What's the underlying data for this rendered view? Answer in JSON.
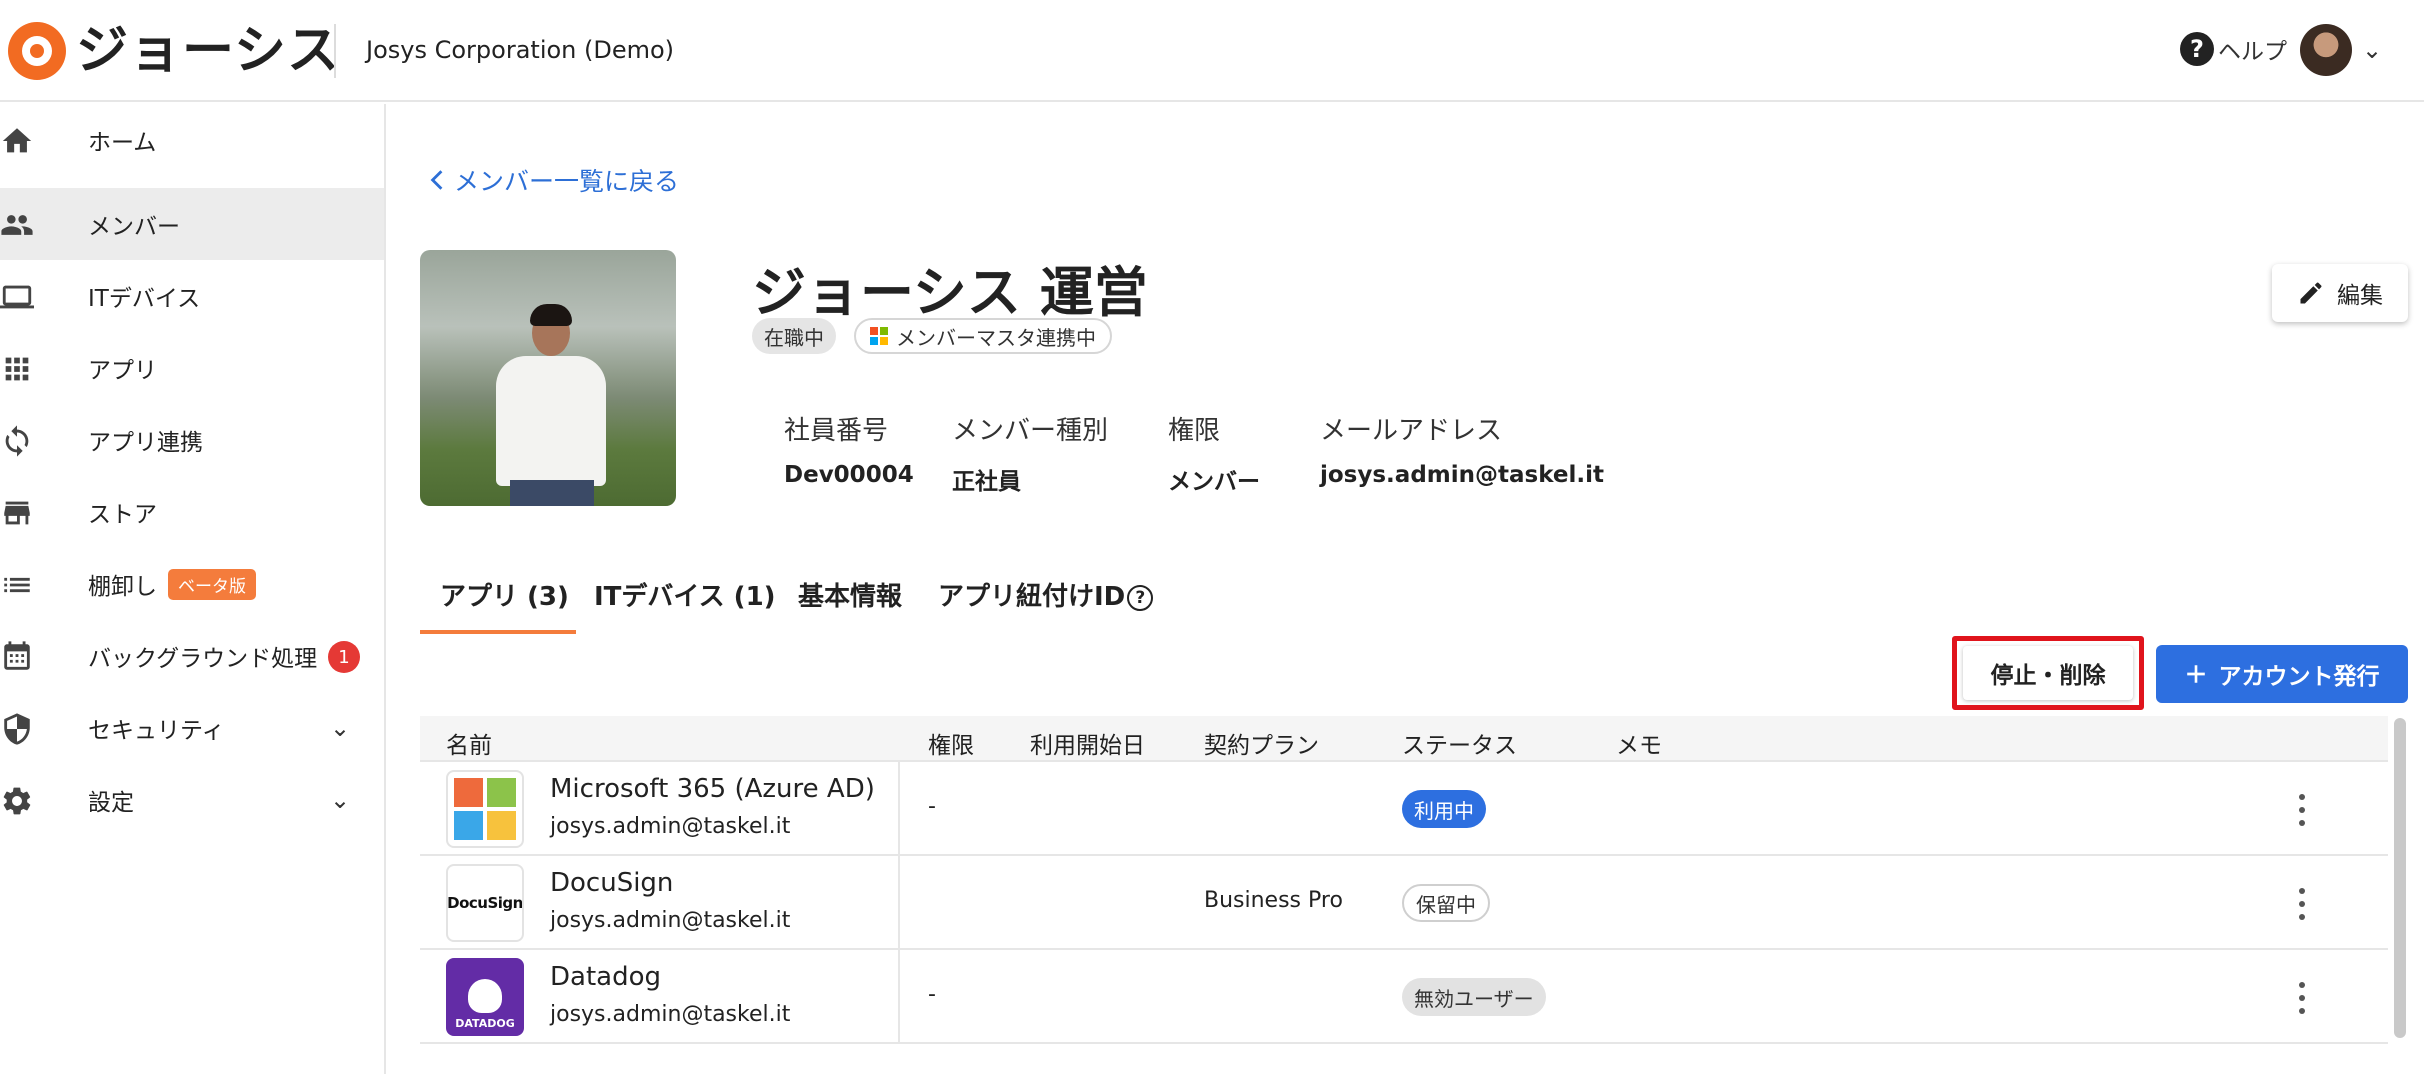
{
  "header": {
    "logo_text": "ジョーシス",
    "org_name": "Josys Corporation (Demo)",
    "help_label": "ヘルプ"
  },
  "sidebar": {
    "items": [
      {
        "label": "ホーム",
        "icon": "home-icon"
      },
      {
        "label": "メンバー",
        "icon": "people-icon",
        "active": true
      },
      {
        "label": "ITデバイス",
        "icon": "laptop-icon"
      },
      {
        "label": "アプリ",
        "icon": "grid-icon"
      },
      {
        "label": "アプリ連携",
        "icon": "sync-icon"
      },
      {
        "label": "ストア",
        "icon": "store-icon"
      },
      {
        "label": "棚卸し",
        "icon": "list-icon",
        "badge": "ベータ版"
      },
      {
        "label": "バックグラウンド処理",
        "icon": "calendar-icon",
        "count": "1"
      },
      {
        "label": "セキュリティ",
        "icon": "shield-icon"
      },
      {
        "label": "設定",
        "icon": "gear-icon"
      }
    ]
  },
  "back_link": "メンバー一覧に戻る",
  "member": {
    "name": "ジョーシス 運営",
    "status": "在職中",
    "sync_label": "メンバーマスタ連携中",
    "fields": [
      {
        "label": "社員番号",
        "value": "Dev00004"
      },
      {
        "label": "メンバー種別",
        "value": "正社員"
      },
      {
        "label": "権限",
        "value": "メンバー"
      },
      {
        "label": "メールアドレス",
        "value": "josys.admin@taskel.it"
      }
    ]
  },
  "edit_label": "編集",
  "tabs": [
    {
      "label": "アプリ (3)",
      "active": true
    },
    {
      "label": "ITデバイス (1)"
    },
    {
      "label": "基本情報"
    },
    {
      "label": "アプリ紐付けID"
    }
  ],
  "tab_help_glyph": "?",
  "actions": {
    "stop_delete": "停止・削除",
    "issue_account": "アカウント発行"
  },
  "table": {
    "columns": [
      "名前",
      "権限",
      "利用開始日",
      "契約プラン",
      "ステータス",
      "メモ"
    ],
    "rows": [
      {
        "name": "Microsoft 365 (Azure AD)",
        "email": "josys.admin@taskel.it",
        "role": "-",
        "start": "",
        "plan": "",
        "status": "利用中",
        "status_bg": "#2d6fe0",
        "status_fg": "#ffffff",
        "logo": "microsoft-logo"
      },
      {
        "name": "DocuSign",
        "email": "josys.admin@taskel.it",
        "role": "",
        "start": "",
        "plan": "Business Pro",
        "status": "保留中",
        "status_bg": "#ffffff",
        "status_fg": "#333333",
        "logo": "docusign-logo",
        "logo_text": "DocuSign"
      },
      {
        "name": "Datadog",
        "email": "josys.admin@taskel.it",
        "role": "-",
        "start": "",
        "plan": "",
        "status": "無効ユーザー",
        "status_bg": "#e2e2e2",
        "status_fg": "#333333",
        "logo": "datadog-logo",
        "logo_text": "DATADOG"
      }
    ]
  },
  "colors": {
    "accent_orange": "#f47c3c",
    "primary_blue": "#2d6fe0",
    "highlight_red": "#e0141c"
  }
}
